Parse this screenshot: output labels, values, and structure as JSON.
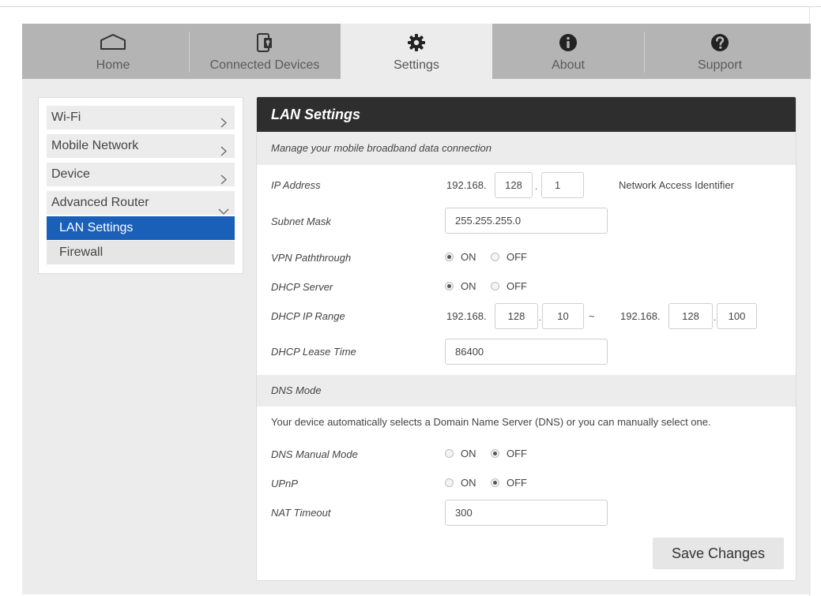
{
  "nav": {
    "tabs": [
      {
        "label": "Home",
        "icon": "home-icon"
      },
      {
        "label": "Connected Devices",
        "icon": "devices-icon"
      },
      {
        "label": "Settings",
        "icon": "gear-icon"
      },
      {
        "label": "About",
        "icon": "info-icon"
      },
      {
        "label": "Support",
        "icon": "help-icon"
      }
    ],
    "active_tab": "Settings"
  },
  "sidebar": {
    "items": [
      {
        "label": "Wi-Fi"
      },
      {
        "label": "Mobile Network"
      },
      {
        "label": "Device"
      },
      {
        "label": "Advanced Router"
      }
    ],
    "sub_items": [
      {
        "label": "LAN Settings",
        "active": true
      },
      {
        "label": "Firewall",
        "active": false
      }
    ]
  },
  "panel": {
    "title": "LAN Settings",
    "description": "Manage your mobile broadband data connection",
    "ip_address": {
      "label": "IP Address",
      "prefix": "192.168.",
      "octet3": "128",
      "octet4": "1",
      "nai_label": "Network Access Identifier"
    },
    "subnet_mask": {
      "label": "Subnet Mask",
      "value": "255.255.255.0"
    },
    "vpn_passthrough": {
      "label": "VPN Paththrough",
      "on_label": "ON",
      "off_label": "OFF",
      "selected": "ON"
    },
    "dhcp_server": {
      "label": "DHCP Server",
      "on_label": "ON",
      "off_label": "OFF",
      "selected": "ON"
    },
    "dhcp_range": {
      "label": "DHCP IP Range",
      "start_prefix": "192.168.",
      "start_octet3": "128",
      "start_octet4": "10",
      "separator": "~",
      "end_prefix": "192.168.",
      "end_octet3": "128",
      "end_octet4": "100"
    },
    "dhcp_lease": {
      "label": "DHCP Lease Time",
      "value": "86400"
    },
    "dns_mode": {
      "title": "DNS Mode",
      "description": "Your device automatically selects a Domain Name Server (DNS) or you can manually select one."
    },
    "dns_manual": {
      "label": "DNS Manual Mode",
      "on_label": "ON",
      "off_label": "OFF",
      "selected": "OFF"
    },
    "upnp": {
      "label": "UPnP",
      "on_label": "ON",
      "off_label": "OFF",
      "selected": "OFF"
    },
    "nat_timeout": {
      "label": "NAT Timeout",
      "value": "300"
    },
    "save_label": "Save Changes"
  },
  "colors": {
    "nav_bg": "#b4b4b4",
    "header_bg": "#2e2e2e",
    "active_sub": "#1a5fb8",
    "page_bg": "#ececec"
  }
}
